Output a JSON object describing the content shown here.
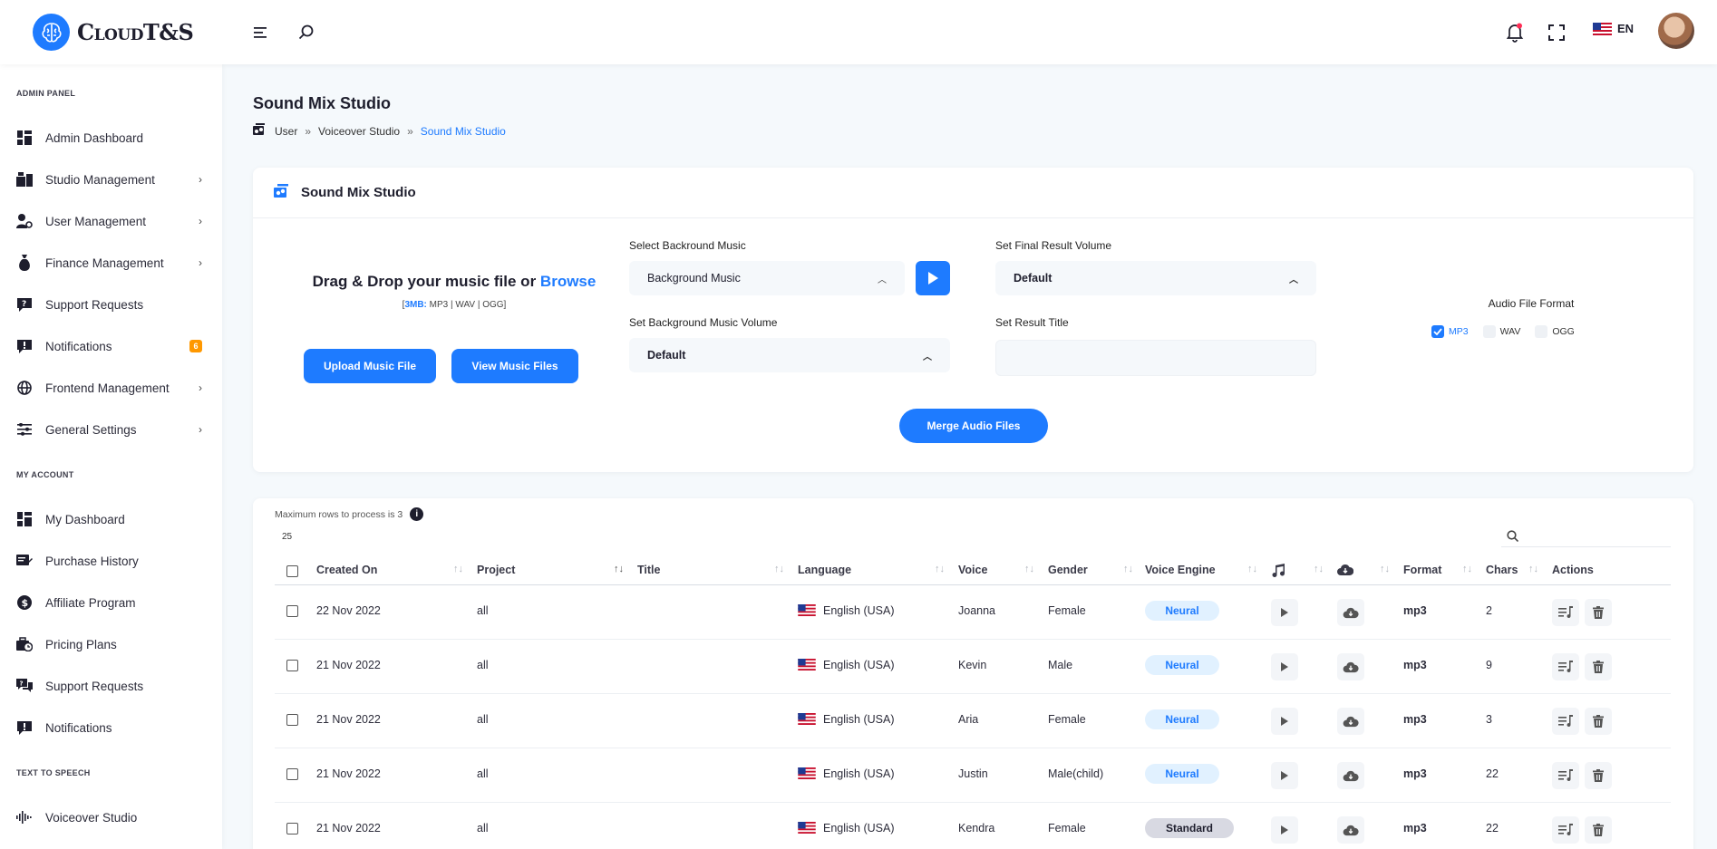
{
  "brand": {
    "name": "CloudT&S"
  },
  "header": {
    "language": "EN"
  },
  "sidebar": {
    "sections": [
      {
        "title": "ADMIN PANEL"
      },
      {
        "title": "MY ACCOUNT"
      },
      {
        "title": "TEXT TO SPEECH"
      }
    ],
    "items": [
      {
        "label": "Admin Dashboard"
      },
      {
        "label": "Studio Management"
      },
      {
        "label": "User Management"
      },
      {
        "label": "Finance Management"
      },
      {
        "label": "Support Requests"
      },
      {
        "label": "Notifications",
        "badge": "6"
      },
      {
        "label": "Frontend Management"
      },
      {
        "label": "General Settings"
      },
      {
        "label": "My Dashboard"
      },
      {
        "label": "Purchase History"
      },
      {
        "label": "Affiliate Program"
      },
      {
        "label": "Pricing Plans"
      },
      {
        "label": "Support Requests"
      },
      {
        "label": "Notifications"
      },
      {
        "label": "Voiceover Studio"
      }
    ]
  },
  "page": {
    "title": "Sound Mix Studio",
    "breadcrumb": [
      "User",
      "Voiceover Studio",
      "Sound Mix Studio"
    ],
    "separator": "»"
  },
  "mixer": {
    "card_title": "Sound Mix Studio",
    "drop_text": "Drag & Drop your music file or",
    "browse": "Browse",
    "limits_prefix": "[",
    "limits_size": "3MB:",
    "limits_rest": " MP3 | WAV | OGG]",
    "upload_button": "Upload Music File",
    "view_button": "View Music Files",
    "bg_music_label": "Select Backround Music",
    "bg_music_value": "Background Music",
    "bg_volume_label": "Set Background Music Volume",
    "bg_volume_value": "Default",
    "final_volume_label": "Set Final Result Volume",
    "final_volume_value": "Default",
    "result_title_label": "Set Result Title",
    "result_title_value": "",
    "format_title": "Audio File Format",
    "formats": [
      {
        "label": "MP3",
        "checked": true
      },
      {
        "label": "WAV",
        "checked": false
      },
      {
        "label": "OGG",
        "checked": false
      }
    ],
    "merge_button": "Merge Audio Files"
  },
  "table": {
    "max_rows": "Maximum rows to process is 3",
    "page_size": "25",
    "columns": [
      "Created On",
      "Project",
      "Title",
      "Language",
      "Voice",
      "Gender",
      "Voice Engine",
      "",
      "",
      "Format",
      "Chars",
      "Actions"
    ],
    "rows": [
      {
        "created": "22 Nov 2022",
        "project": "all",
        "title": "",
        "language": "English (USA)",
        "voice": "Joanna",
        "gender": "Female",
        "engine": "Neural",
        "format": "mp3",
        "chars": "2"
      },
      {
        "created": "21 Nov 2022",
        "project": "all",
        "title": "",
        "language": "English (USA)",
        "voice": "Kevin",
        "gender": "Male",
        "engine": "Neural",
        "format": "mp3",
        "chars": "9"
      },
      {
        "created": "21 Nov 2022",
        "project": "all",
        "title": "",
        "language": "English (USA)",
        "voice": "Aria",
        "gender": "Female",
        "engine": "Neural",
        "format": "mp3",
        "chars": "3"
      },
      {
        "created": "21 Nov 2022",
        "project": "all",
        "title": "",
        "language": "English (USA)",
        "voice": "Justin",
        "gender": "Male(child)",
        "engine": "Neural",
        "format": "mp3",
        "chars": "22"
      },
      {
        "created": "21 Nov 2022",
        "project": "all",
        "title": "",
        "language": "English (USA)",
        "voice": "Kendra",
        "gender": "Female",
        "engine": "Standard",
        "format": "mp3",
        "chars": "22"
      }
    ]
  },
  "colors": {
    "accent": "#1e7bff",
    "badge": "#ff9800",
    "neural_bg": "#e1f1ff",
    "standard_bg": "#d8d9e2"
  }
}
